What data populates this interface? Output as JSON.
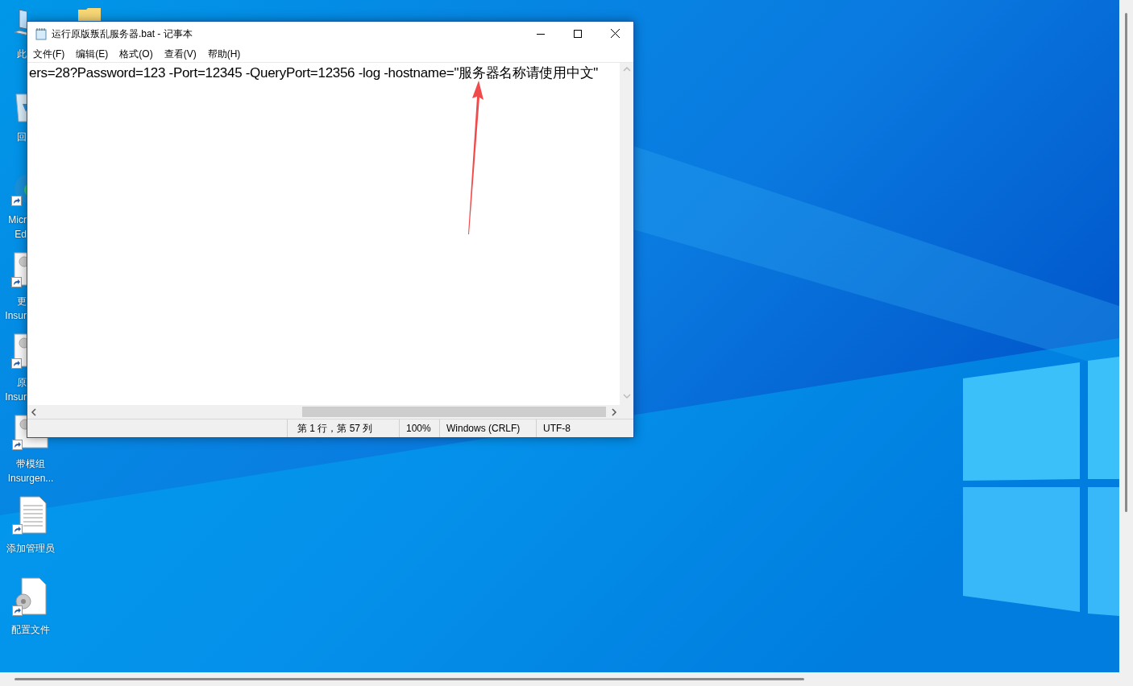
{
  "desktop_icons": [
    {
      "kind": "computer",
      "cut": true,
      "label_lines": [
        "此"
      ]
    },
    {
      "kind": "recycle",
      "cut": true,
      "label_lines": [
        "回"
      ]
    },
    {
      "kind": "browser",
      "cut": true,
      "label_lines": [
        "Micr",
        "Ed"
      ]
    },
    {
      "kind": "app",
      "cut": true,
      "label_lines": [
        "更",
        "Insur"
      ]
    },
    {
      "kind": "app",
      "cut": true,
      "label_lines": [
        "原",
        "Insur"
      ]
    },
    {
      "kind": "app",
      "cut": false,
      "label_lines": [
        "带模组",
        "Insurgen..."
      ]
    },
    {
      "kind": "document",
      "cut": false,
      "label_lines": [
        "添加管理员"
      ]
    },
    {
      "kind": "config",
      "cut": false,
      "label_lines": [
        "配置文件"
      ]
    }
  ],
  "window": {
    "title": "运行原版叛乱服务器.bat - 记事本",
    "menu": [
      "文件(F)",
      "编辑(E)",
      "格式(O)",
      "查看(V)",
      "帮助(H)"
    ],
    "text": "ers=28?Password=123 -Port=12345 -QueryPort=12356 -log -hostname=\"服务器名称请使用中文\"",
    "status_bar": [
      "第 1 行，第 57 列",
      "100%",
      "Windows (CRLF)",
      "UTF-8"
    ]
  }
}
